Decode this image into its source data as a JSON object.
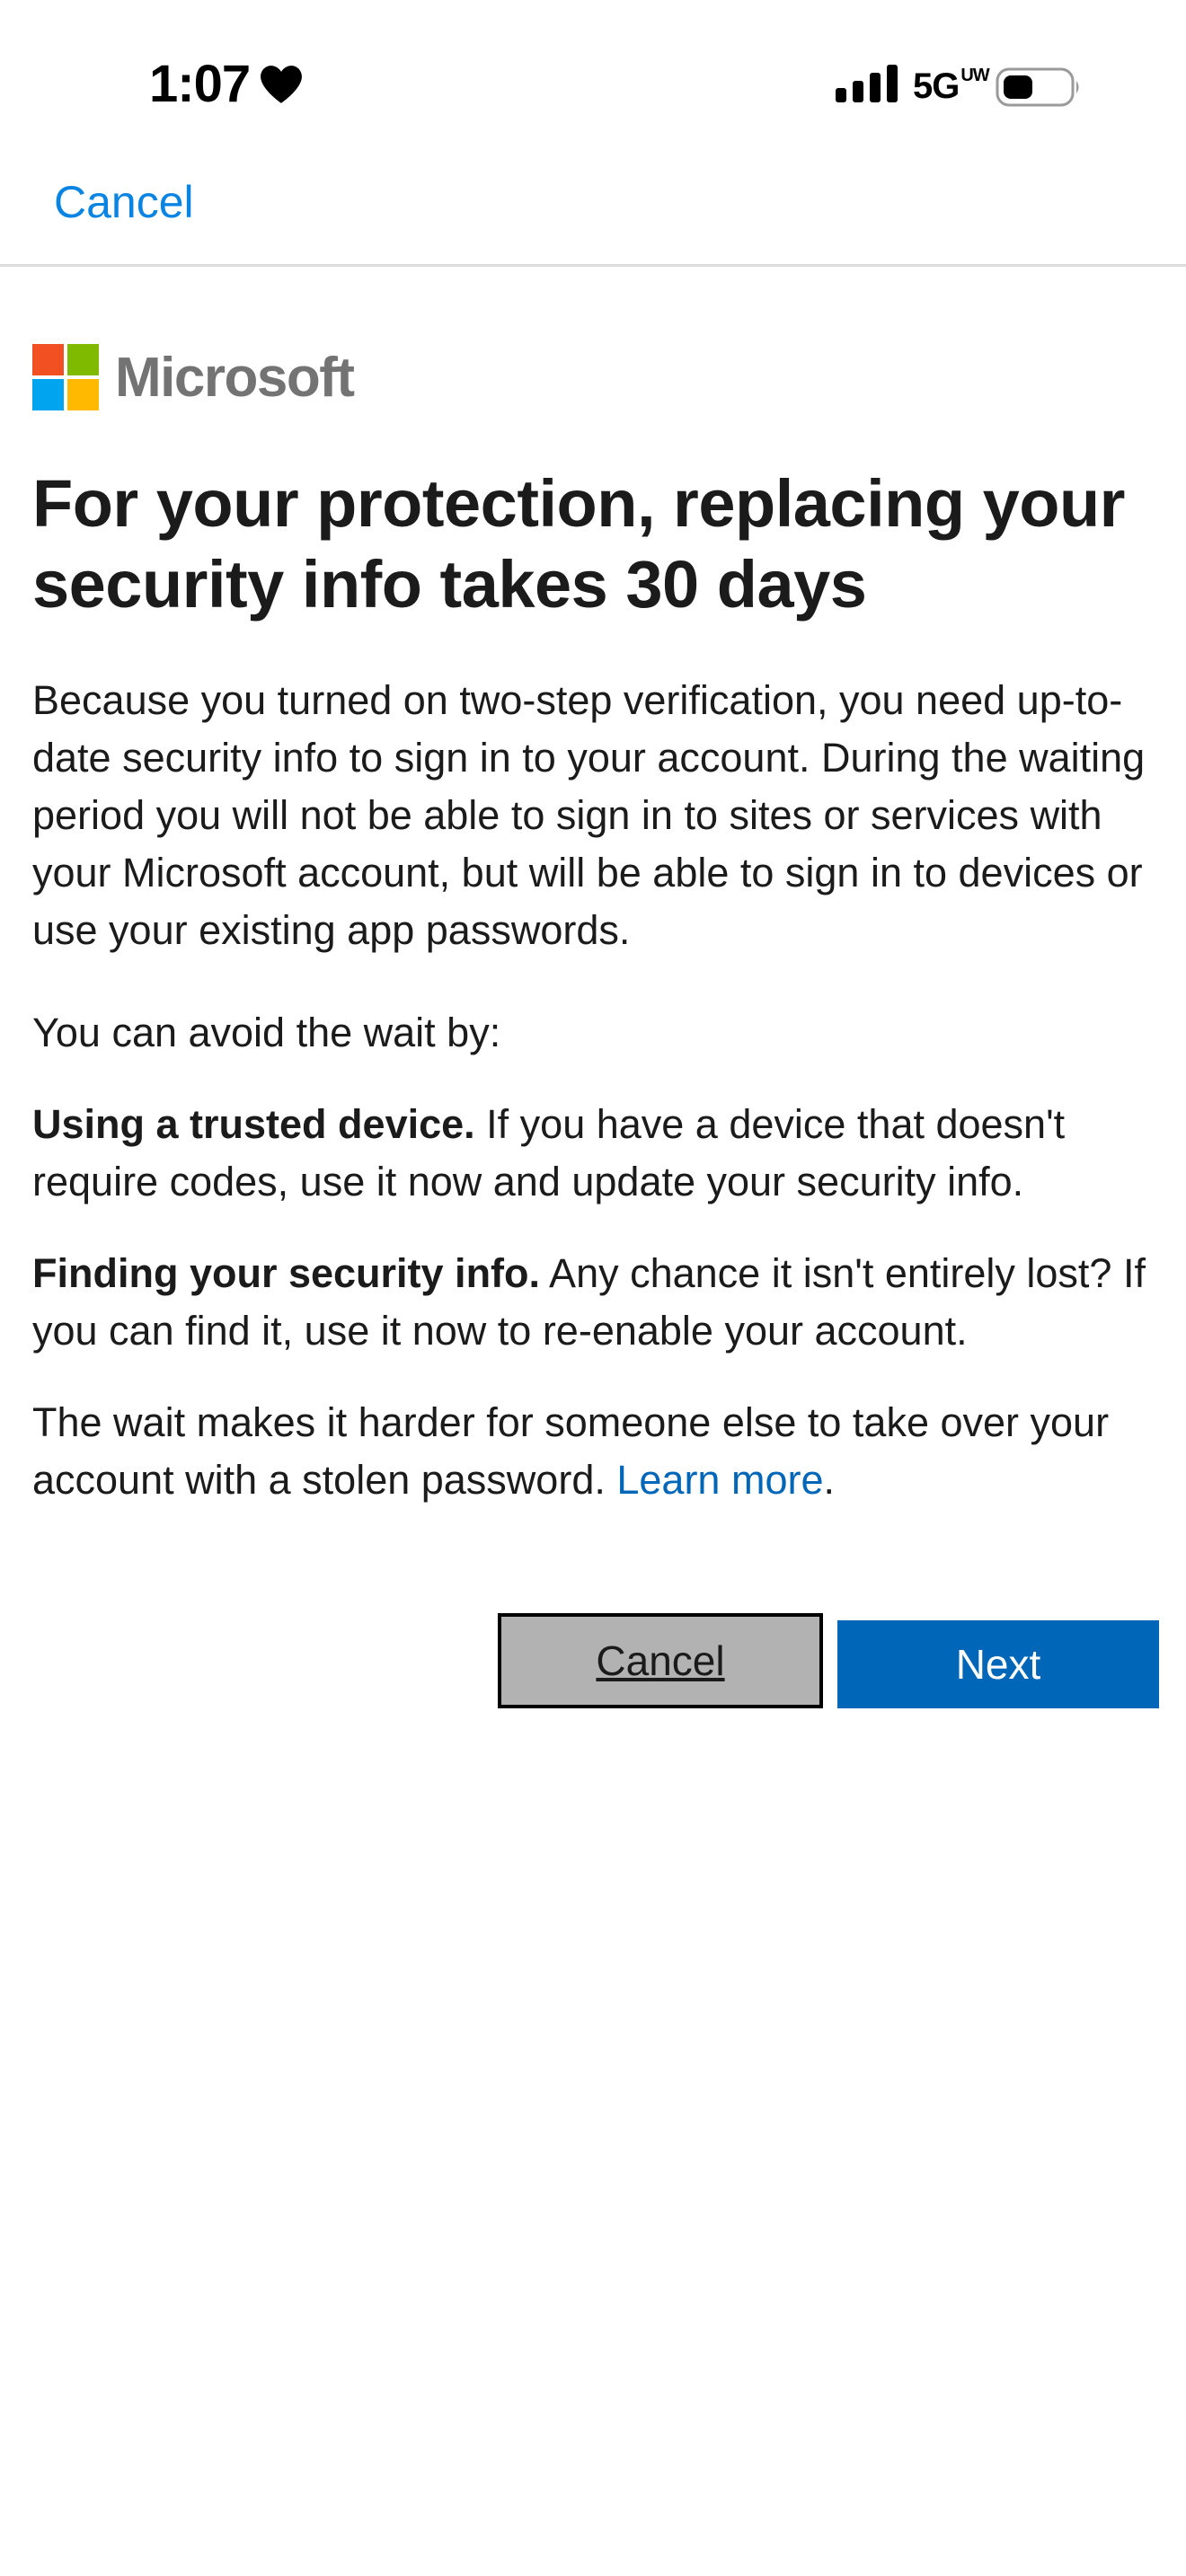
{
  "status_bar": {
    "time": "1:07",
    "network": "5G",
    "network_suffix": "UW"
  },
  "nav": {
    "cancel_label": "Cancel"
  },
  "brand": {
    "name": "Microsoft",
    "colors": [
      "#f25022",
      "#7fba00",
      "#00a4ef",
      "#ffb900"
    ]
  },
  "main": {
    "title": "For your protection, replacing your security info takes 30 days",
    "intro": "Because you turned on two-step verification, you need up-to-date security info to sign in to your account. During the waiting period you will not be able to sign in to sites or services with your Microsoft account, but will be able to sign in to devices or use your existing app passwords.",
    "avoid_intro": "You can avoid the wait by:",
    "option1_bold": "Using a trusted device.",
    "option1_text": " If you have a device that doesn't require codes, use it now and update your security info.",
    "option2_bold": "Finding your security info.",
    "option2_text": " Any chance it isn't entirely lost? If you can find it, use it now to re-enable your account.",
    "wait_text": "The wait makes it harder for someone else to take over your account with a stolen password. ",
    "learn_more": "Learn more",
    "period": "."
  },
  "buttons": {
    "cancel": "Cancel",
    "next": "Next"
  },
  "colors": {
    "accent": "#0067b8",
    "nav_link": "#0a84e3",
    "cancel_bg": "#b2b2b2"
  }
}
